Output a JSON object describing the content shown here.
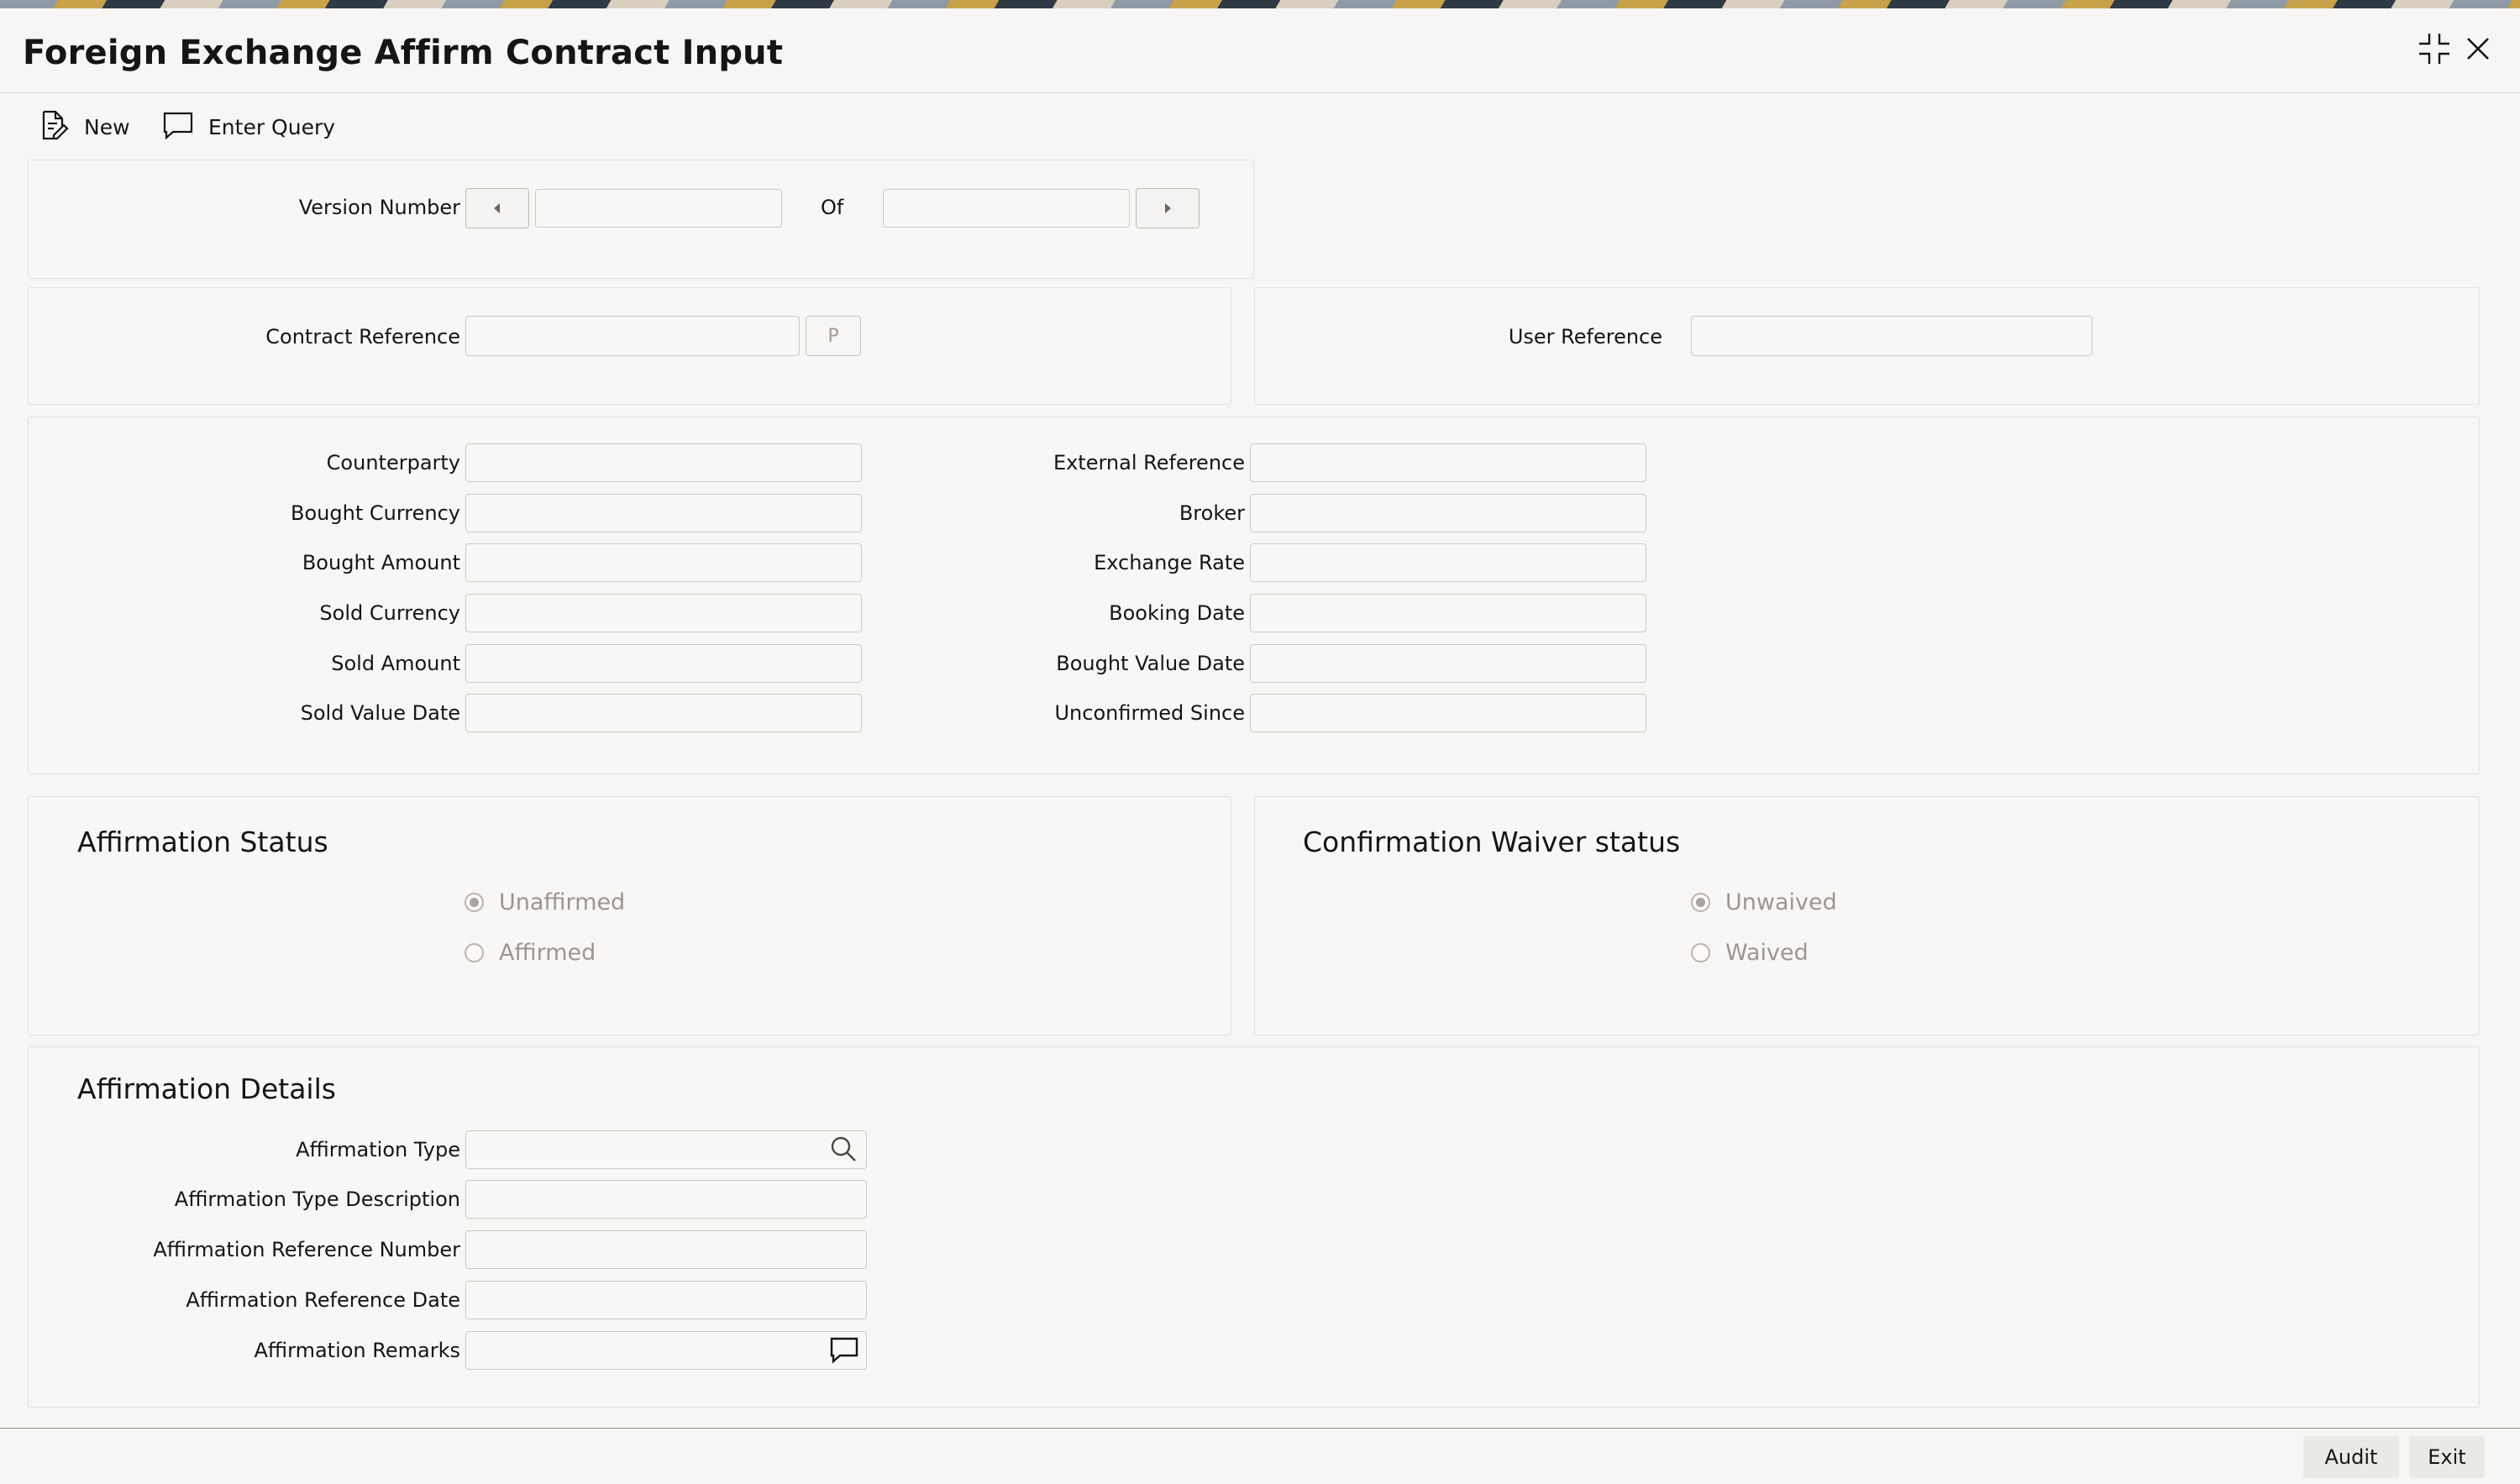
{
  "window": {
    "title": "Foreign Exchange Affirm Contract Input",
    "maximize_icon": "minimize-arrows-icon",
    "close_icon": "close-icon"
  },
  "toolbar": {
    "new_label": "New",
    "enter_query_label": "Enter Query"
  },
  "version": {
    "label": "Version Number",
    "current": "",
    "of_label": "Of",
    "total": ""
  },
  "contract": {
    "contract_reference_label": "Contract Reference",
    "contract_reference_value": "",
    "p_button_label": "P",
    "user_reference_label": "User Reference",
    "user_reference_value": ""
  },
  "details": {
    "left": [
      {
        "label": "Counterparty",
        "value": ""
      },
      {
        "label": "Bought Currency",
        "value": ""
      },
      {
        "label": "Bought Amount",
        "value": ""
      },
      {
        "label": "Sold Currency",
        "value": ""
      },
      {
        "label": "Sold Amount",
        "value": ""
      },
      {
        "label": "Sold Value Date",
        "value": ""
      }
    ],
    "right": [
      {
        "label": "External Reference",
        "value": ""
      },
      {
        "label": "Broker",
        "value": ""
      },
      {
        "label": "Exchange Rate",
        "value": ""
      },
      {
        "label": "Booking Date",
        "value": ""
      },
      {
        "label": "Bought Value Date",
        "value": ""
      },
      {
        "label": "Unconfirmed Since",
        "value": ""
      }
    ]
  },
  "affirmation_status": {
    "title": "Affirmation Status",
    "options": [
      "Unaffirmed",
      "Affirmed"
    ],
    "selected": "Unaffirmed"
  },
  "waiver_status": {
    "title": "Confirmation Waiver status",
    "options": [
      "Unwaived",
      "Waived"
    ],
    "selected": "Unwaived"
  },
  "affirmation_details": {
    "title": "Affirmation Details",
    "fields": [
      {
        "label": "Affirmation Type",
        "value": "",
        "icon": "search-icon"
      },
      {
        "label": "Affirmation Type Description",
        "value": ""
      },
      {
        "label": "Affirmation Reference Number",
        "value": ""
      },
      {
        "label": "Affirmation Reference Date",
        "value": ""
      },
      {
        "label": "Affirmation Remarks",
        "value": "",
        "icon": "comment-icon"
      }
    ]
  },
  "footer": {
    "audit_label": "Audit",
    "exit_label": "Exit"
  }
}
